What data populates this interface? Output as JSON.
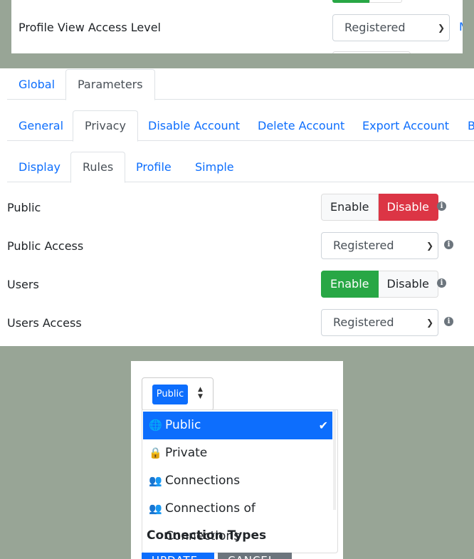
{
  "panel_top": {
    "label": "Profile View Access Level",
    "select_value": "Registered",
    "more_link": "M"
  },
  "tabs_level1": [
    "Global",
    "Parameters"
  ],
  "tabs_level2": [
    "General",
    "Privacy",
    "Disable Account",
    "Delete Account",
    "Export Account",
    "B"
  ],
  "tabs_level3": [
    "Display",
    "Rules",
    "Profile",
    "Simple"
  ],
  "rules": {
    "public": {
      "label": "Public",
      "enable": "Enable",
      "disable": "Disable"
    },
    "public_access": {
      "label": "Public Access",
      "value": "Registered"
    },
    "users": {
      "label": "Users",
      "enable": "Enable",
      "disable": "Disable"
    },
    "users_access": {
      "label": "Users Access",
      "value": "Registered"
    }
  },
  "dropdown": {
    "selected_pill": "Public",
    "options": [
      "Public",
      "Private",
      "Connections",
      "Connections of Connections"
    ],
    "group_header": "Connection Types",
    "update_button": "UPDATE",
    "cancel_button": "CANCEL"
  },
  "colors": {
    "primary": "#0d6efd",
    "danger": "#dc3545",
    "success": "#28a745",
    "background": "#98a596"
  }
}
